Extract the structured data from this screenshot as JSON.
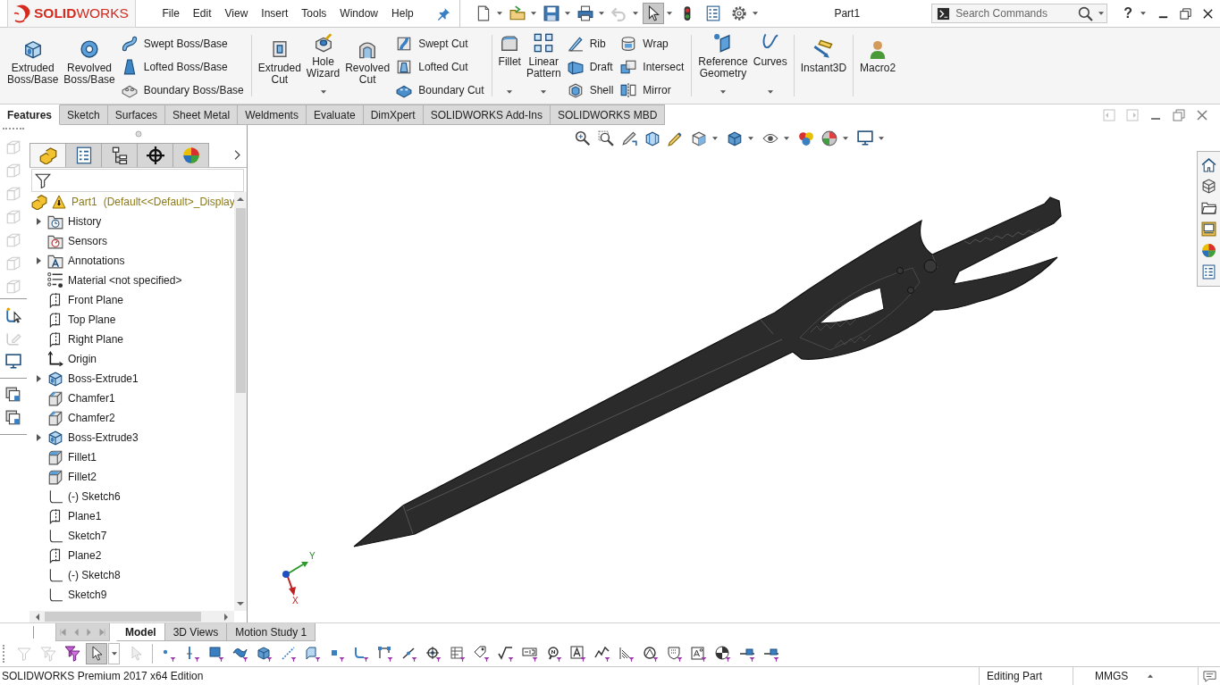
{
  "title_bar": {
    "logo": "**SOLID**WORKS",
    "menu": [
      "File",
      "Edit",
      "View",
      "Insert",
      "Tools",
      "Window",
      "Help"
    ],
    "quick_access": [
      {
        "kind": "new",
        "dropdown": true,
        "disabled": false,
        "pressed": false
      },
      {
        "kind": "open",
        "dropdown": true,
        "disabled": false,
        "pressed": false
      },
      {
        "kind": "save",
        "dropdown": true,
        "disabled": false,
        "pressed": false
      },
      {
        "kind": "print",
        "dropdown": true,
        "disabled": false,
        "pressed": false
      },
      {
        "kind": "undo",
        "dropdown": true,
        "disabled": true,
        "pressed": false
      },
      {
        "kind": "select",
        "dropdown": true,
        "disabled": false,
        "pressed": true
      },
      {
        "kind": "rebuild",
        "disabled": false,
        "pressed": false
      },
      {
        "kind": "properties",
        "disabled": false,
        "pressed": false
      },
      {
        "kind": "options",
        "dropdown": true,
        "disabled": false,
        "pressed": false
      }
    ],
    "document_title": "Part1",
    "search": {
      "placeholder": "Search Commands"
    },
    "help": "?"
  },
  "ribbon": {
    "groups": [
      {
        "columns": [
          {
            "kind": "large",
            "label": "Extruded Boss/Base"
          },
          {
            "kind": "large",
            "label": "Revolved Boss/Base"
          },
          {
            "kind": "stack",
            "items": [
              "Swept Boss/Base",
              "Lofted Boss/Base",
              "Boundary Boss/Base"
            ]
          }
        ]
      },
      {
        "columns": [
          {
            "kind": "large",
            "label": "Extruded Cut"
          },
          {
            "kind": "large",
            "label": "Hole Wizard",
            "dropdown": true
          },
          {
            "kind": "large",
            "label": "Revolved Cut"
          },
          {
            "kind": "stack",
            "items": [
              "Swept Cut",
              "Lofted Cut",
              "Boundary Cut"
            ]
          }
        ]
      },
      {
        "columns": [
          {
            "kind": "large",
            "label": "Fillet",
            "dropdown": true
          },
          {
            "kind": "large",
            "label": "Linear Pattern",
            "dropdown": true
          },
          {
            "kind": "stack",
            "items": [
              "Rib",
              "Draft",
              "Shell"
            ]
          },
          {
            "kind": "stack",
            "items": [
              "Wrap",
              "Intersect",
              "Mirror"
            ]
          }
        ]
      },
      {
        "columns": [
          {
            "kind": "large",
            "label": "Reference Geometry",
            "dropdown": true
          },
          {
            "kind": "large",
            "label": "Curves",
            "dropdown": true
          }
        ]
      },
      {
        "columns": [
          {
            "kind": "large",
            "label": "Instant3D"
          }
        ]
      },
      {
        "columns": [
          {
            "kind": "large",
            "label": "Macro2"
          }
        ]
      }
    ]
  },
  "command_tabs": [
    {
      "label": "Features",
      "selected": true
    },
    {
      "label": "Sketch",
      "selected": false
    },
    {
      "label": "Surfaces",
      "selected": false
    },
    {
      "label": "Sheet Metal",
      "selected": false
    },
    {
      "label": "Weldments",
      "selected": false
    },
    {
      "label": "Evaluate",
      "selected": false
    },
    {
      "label": "DimXpert",
      "selected": false
    },
    {
      "label": "SOLIDWORKS Add-Ins",
      "selected": false
    },
    {
      "label": "SOLIDWORKS MBD",
      "selected": false
    }
  ],
  "left_toolbar": [
    {
      "items": [
        {
          "kind": "cube",
          "disabled": true
        },
        {
          "kind": "cube",
          "disabled": true
        },
        {
          "kind": "cube",
          "disabled": true
        },
        {
          "kind": "cube",
          "disabled": true
        },
        {
          "kind": "cube",
          "disabled": true
        },
        {
          "kind": "cube",
          "disabled": true
        },
        {
          "kind": "cube",
          "disabled": true
        }
      ]
    },
    {
      "items": [
        {
          "kind": "sketch-pointer",
          "disabled": false
        },
        {
          "kind": "sketch-edit",
          "disabled": true
        },
        {
          "kind": "monitor",
          "disabled": false
        }
      ]
    },
    {
      "items": [
        {
          "kind": "windows",
          "disabled": false
        },
        {
          "kind": "windows",
          "disabled": false
        }
      ]
    }
  ],
  "feature_manager": {
    "tabs": [
      {
        "kind": "features",
        "selected": true
      },
      {
        "kind": "properties",
        "selected": false
      },
      {
        "kind": "configurations",
        "selected": false
      },
      {
        "kind": "dimxpert",
        "selected": false
      },
      {
        "kind": "display",
        "selected": false
      }
    ],
    "tree": {
      "root": {
        "name": "Part1",
        "configuration": "(Default<<Default>_Display"
      },
      "items": [
        {
          "label": "History",
          "kind": "history",
          "expanded": false
        },
        {
          "label": "Sensors",
          "kind": "sensors"
        },
        {
          "label": "Annotations",
          "kind": "annotations",
          "expanded": false
        },
        {
          "label": "Material <not specified>",
          "kind": "material"
        },
        {
          "label": "Front Plane",
          "kind": "plane"
        },
        {
          "label": "Top Plane",
          "kind": "plane"
        },
        {
          "label": "Right Plane",
          "kind": "plane"
        },
        {
          "label": "Origin",
          "kind": "origin"
        },
        {
          "label": "Boss-Extrude1",
          "kind": "extrude",
          "expanded": false
        },
        {
          "label": "Chamfer1",
          "kind": "chamfer"
        },
        {
          "label": "Chamfer2",
          "kind": "chamfer"
        },
        {
          "label": "Boss-Extrude3",
          "kind": "extrude",
          "expanded": false
        },
        {
          "label": "Fillet1",
          "kind": "fillet"
        },
        {
          "label": "Fillet2",
          "kind": "fillet"
        },
        {
          "label": "(-) Sketch6",
          "kind": "sketch"
        },
        {
          "label": "Plane1",
          "kind": "plane"
        },
        {
          "label": "Sketch7",
          "kind": "sketch"
        },
        {
          "label": "Plane2",
          "kind": "plane"
        },
        {
          "label": "(-) Sketch8",
          "kind": "sketch"
        },
        {
          "label": "Sketch9",
          "kind": "sketch"
        }
      ]
    }
  },
  "triad": {
    "y_label": "Y",
    "x_label": "X"
  },
  "bottom_tabs": {
    "scroll_disabled": true,
    "tabs": [
      {
        "label": "Model",
        "selected": true
      },
      {
        "label": "3D Views",
        "selected": false
      },
      {
        "label": "Motion Study 1",
        "selected": false
      }
    ]
  },
  "selection_toolbar": [
    {
      "kind": "filter",
      "disabled": true,
      "pressed": false
    },
    {
      "kind": "filters",
      "disabled": true,
      "pressed": false
    },
    {
      "kind": "filters-color",
      "disabled": false,
      "pressed": false
    },
    {
      "kind": "select",
      "dropdown": true,
      "disabled": false,
      "pressed": true
    },
    {
      "kind": "select-other",
      "disabled": true,
      "pressed": false
    },
    {
      "kind": "point",
      "disabled": false,
      "pressed": false
    },
    {
      "kind": "axis",
      "disabled": false,
      "pressed": false
    },
    {
      "kind": "face",
      "disabled": false,
      "pressed": false
    },
    {
      "kind": "surface",
      "disabled": false,
      "pressed": false
    },
    {
      "kind": "solid",
      "disabled": false,
      "pressed": false
    },
    {
      "kind": "edge",
      "disabled": false,
      "pressed": false
    },
    {
      "kind": "plane",
      "disabled": false,
      "pressed": false
    },
    {
      "kind": "vertex",
      "disabled": false,
      "pressed": false
    },
    {
      "kind": "curve",
      "disabled": false,
      "pressed": false
    },
    {
      "kind": "polyline",
      "disabled": false,
      "pressed": false
    },
    {
      "kind": "line",
      "disabled": false,
      "pressed": false
    },
    {
      "kind": "target",
      "disabled": false,
      "pressed": false
    },
    {
      "kind": "grid",
      "disabled": false,
      "pressed": false
    },
    {
      "kind": "tag",
      "disabled": false,
      "pressed": false
    },
    {
      "kind": "check",
      "disabled": false,
      "pressed": false
    },
    {
      "kind": "labelbox",
      "disabled": false,
      "pressed": false
    },
    {
      "kind": "magnifier",
      "disabled": false,
      "pressed": false
    },
    {
      "kind": "letter",
      "disabled": false,
      "pressed": false
    },
    {
      "kind": "zigzag",
      "disabled": false,
      "pressed": false
    },
    {
      "kind": "hatch",
      "disabled": false,
      "pressed": false
    },
    {
      "kind": "circle",
      "disabled": false,
      "pressed": false
    },
    {
      "kind": "shield",
      "disabled": false,
      "pressed": false
    },
    {
      "kind": "boxletter",
      "disabled": false,
      "pressed": false
    },
    {
      "kind": "ball",
      "disabled": false,
      "pressed": false
    },
    {
      "kind": "pin",
      "disabled": false,
      "pressed": false
    },
    {
      "kind": "pin",
      "disabled": false,
      "pressed": false
    }
  ],
  "status_bar": {
    "product": "SOLIDWORKS Premium 2017 x64 Edition",
    "mode": "Editing Part",
    "units": "MMGS"
  }
}
